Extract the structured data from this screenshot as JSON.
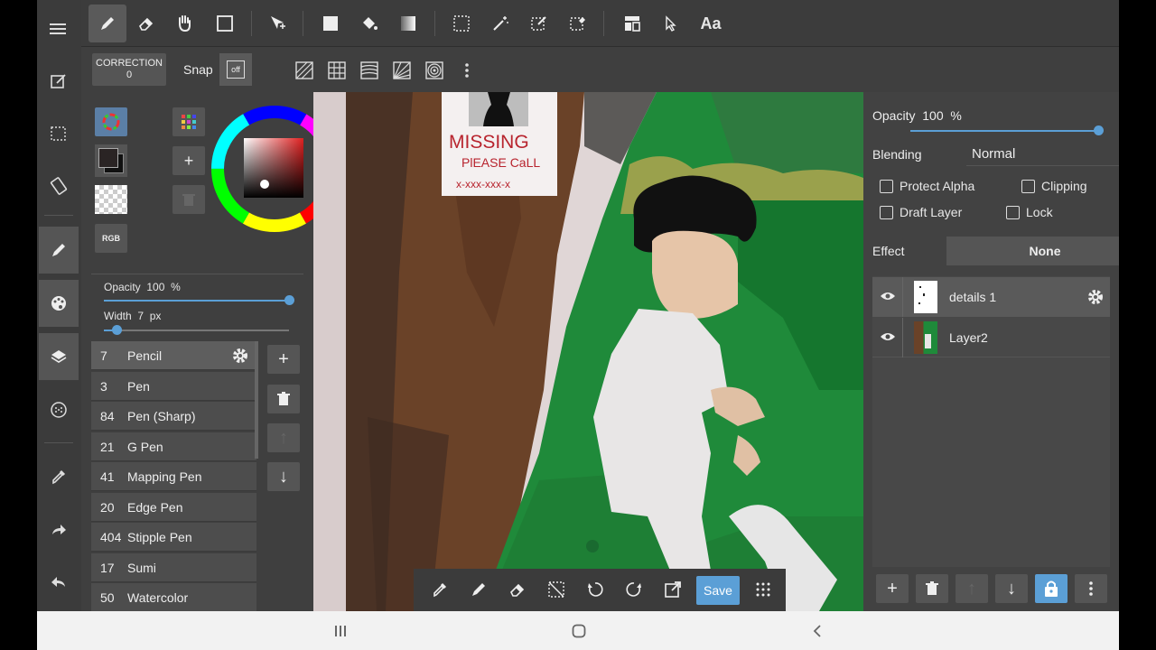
{
  "toolbar": {
    "font_button": "Aa"
  },
  "subbar": {
    "correction_label": "CORRECTION",
    "correction_value": "0",
    "snap_label": "Snap",
    "snap_off": "off"
  },
  "color_panel": {
    "rgb_label": "RGB",
    "current_color": "#2a2424",
    "secondary_color": "#111111"
  },
  "brush_settings": {
    "opacity_label": "Opacity",
    "opacity_value": "100",
    "opacity_unit": "%",
    "opacity_level": 1.0,
    "width_label": "Width",
    "width_value": "7",
    "width_unit": "px",
    "width_level": 0.07
  },
  "brushes": [
    {
      "size": "7",
      "name": "Pencil"
    },
    {
      "size": "3",
      "name": "Pen"
    },
    {
      "size": "84",
      "name": "Pen (Sharp)"
    },
    {
      "size": "21",
      "name": "G Pen"
    },
    {
      "size": "41",
      "name": "Mapping Pen"
    },
    {
      "size": "20",
      "name": "Edge Pen"
    },
    {
      "size": "404",
      "name": "Stipple Pen"
    },
    {
      "size": "17",
      "name": "Sumi"
    },
    {
      "size": "50",
      "name": "Watercolor"
    }
  ],
  "canvas": {
    "poster_line1": "MISSING",
    "poster_line2": "PlEASE CaLL",
    "poster_line3": "x-xxx-xxx-x"
  },
  "layer_panel": {
    "opacity_label": "Opacity",
    "opacity_value": "100",
    "opacity_unit": "%",
    "opacity_level": 1.0,
    "blending_label": "Blending",
    "blending_value": "Normal",
    "protect_alpha": "Protect Alpha",
    "clipping": "Clipping",
    "draft_layer": "Draft Layer",
    "lock": "Lock",
    "effect_label": "Effect",
    "effect_value": "None",
    "layers": [
      {
        "name": "details 1"
      },
      {
        "name": "Layer2"
      }
    ]
  },
  "floatbar": {
    "save_label": "Save"
  },
  "colors": {
    "accent": "#5b9fd6",
    "panel": "#3f3f3f"
  }
}
